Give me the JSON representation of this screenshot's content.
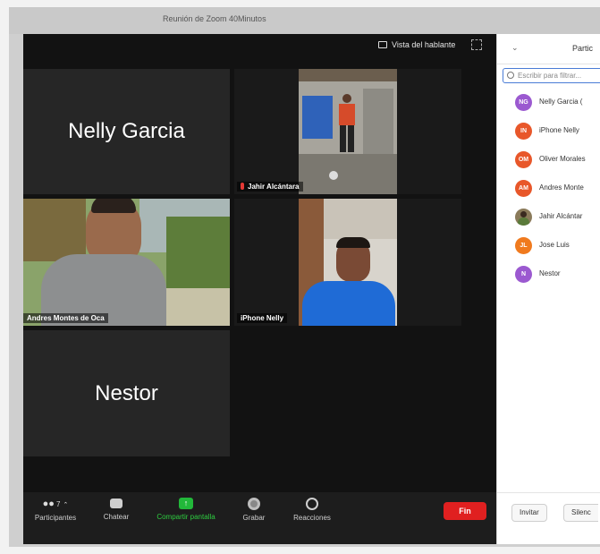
{
  "window": {
    "title": "Reunión de Zoom  40Minutos"
  },
  "topbar": {
    "view_label": "Vista del hablante"
  },
  "tiles": [
    {
      "name": "Nelly Garcia"
    },
    {
      "label": "Jahir Alcántara"
    },
    {
      "label": "Andres Montes de Oca"
    },
    {
      "label": "iPhone Nelly"
    },
    {
      "name": "Nestor"
    }
  ],
  "controls": {
    "participants_count": "7",
    "participants_label": "Participantes",
    "chat_label": "Chatear",
    "share_label": "Compartir pantalla",
    "record_label": "Grabar",
    "reactions_label": "Reacciones",
    "end_label": "Fin"
  },
  "panel": {
    "title": "Partic",
    "search_placeholder": "Escribir para filtrar...",
    "participants": [
      {
        "initials": "NG",
        "name": "Nelly Garcia (",
        "color": "#9b59d0"
      },
      {
        "initials": "IN",
        "name": "iPhone Nelly",
        "color": "#e8572a"
      },
      {
        "initials": "OM",
        "name": "Oliver Morales",
        "color": "#e8572a"
      },
      {
        "initials": "AM",
        "name": "Andres Monte",
        "color": "#e8572a"
      },
      {
        "initials": "",
        "name": "Jahir Alcántar",
        "color": "#8a7a5a"
      },
      {
        "initials": "JL",
        "name": "Jose Luis",
        "color": "#f07a1e"
      },
      {
        "initials": "N",
        "name": "Nestor",
        "color": "#9b59d0"
      }
    ],
    "invite_label": "Invitar",
    "mute_label": "Silenc"
  }
}
